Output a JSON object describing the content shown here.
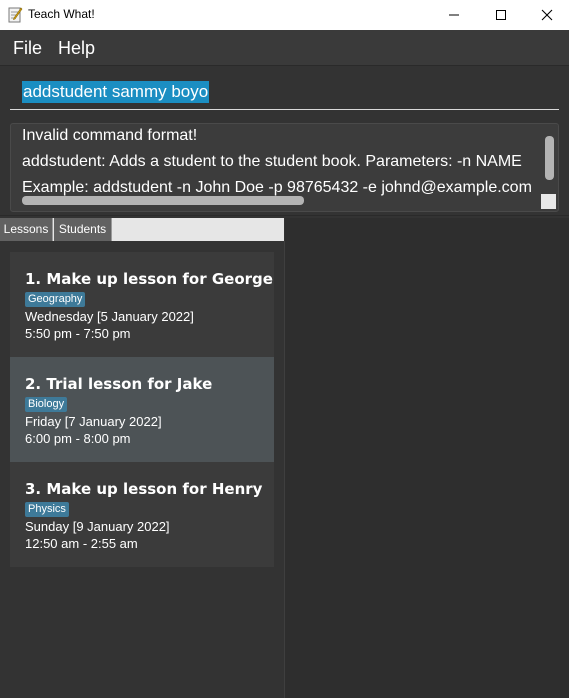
{
  "window": {
    "title": "Teach What!",
    "controls": {
      "minimize": "minimize-icon",
      "maximize": "maximize-icon",
      "close": "close-icon"
    }
  },
  "menu": {
    "file": "File",
    "help": "Help"
  },
  "command": {
    "value": "addstudent sammy boyo",
    "selection_color": "#1b8ec2"
  },
  "result": {
    "lines": [
      "Invalid command format!",
      "addstudent: Adds a student to the student book. Parameters: -n NAME",
      "Example: addstudent -n John Doe -p 98765432 -e johnd@example.com"
    ]
  },
  "tabs": [
    {
      "label": "Lessons"
    },
    {
      "label": "Students"
    }
  ],
  "lessons": [
    {
      "title": "1.  Make up lesson for George",
      "subject": "Geography",
      "date": "Wednesday [5 January 2022]",
      "time": "5:50 pm - 7:50 pm",
      "selected": false
    },
    {
      "title": "2.  Trial lesson for Jake",
      "subject": "Biology",
      "date": "Friday [7 January 2022]",
      "time": "6:00 pm - 8:00 pm",
      "selected": true
    },
    {
      "title": "3.  Make up lesson for Henry",
      "subject": "Physics",
      "date": "Sunday [9 January 2022]",
      "time": "12:50 am - 2:55 am",
      "selected": false
    }
  ],
  "colors": {
    "background": "#333333",
    "card": "#3b3b3b",
    "card_selected": "#4d5356",
    "tag": "#3e7a99"
  }
}
